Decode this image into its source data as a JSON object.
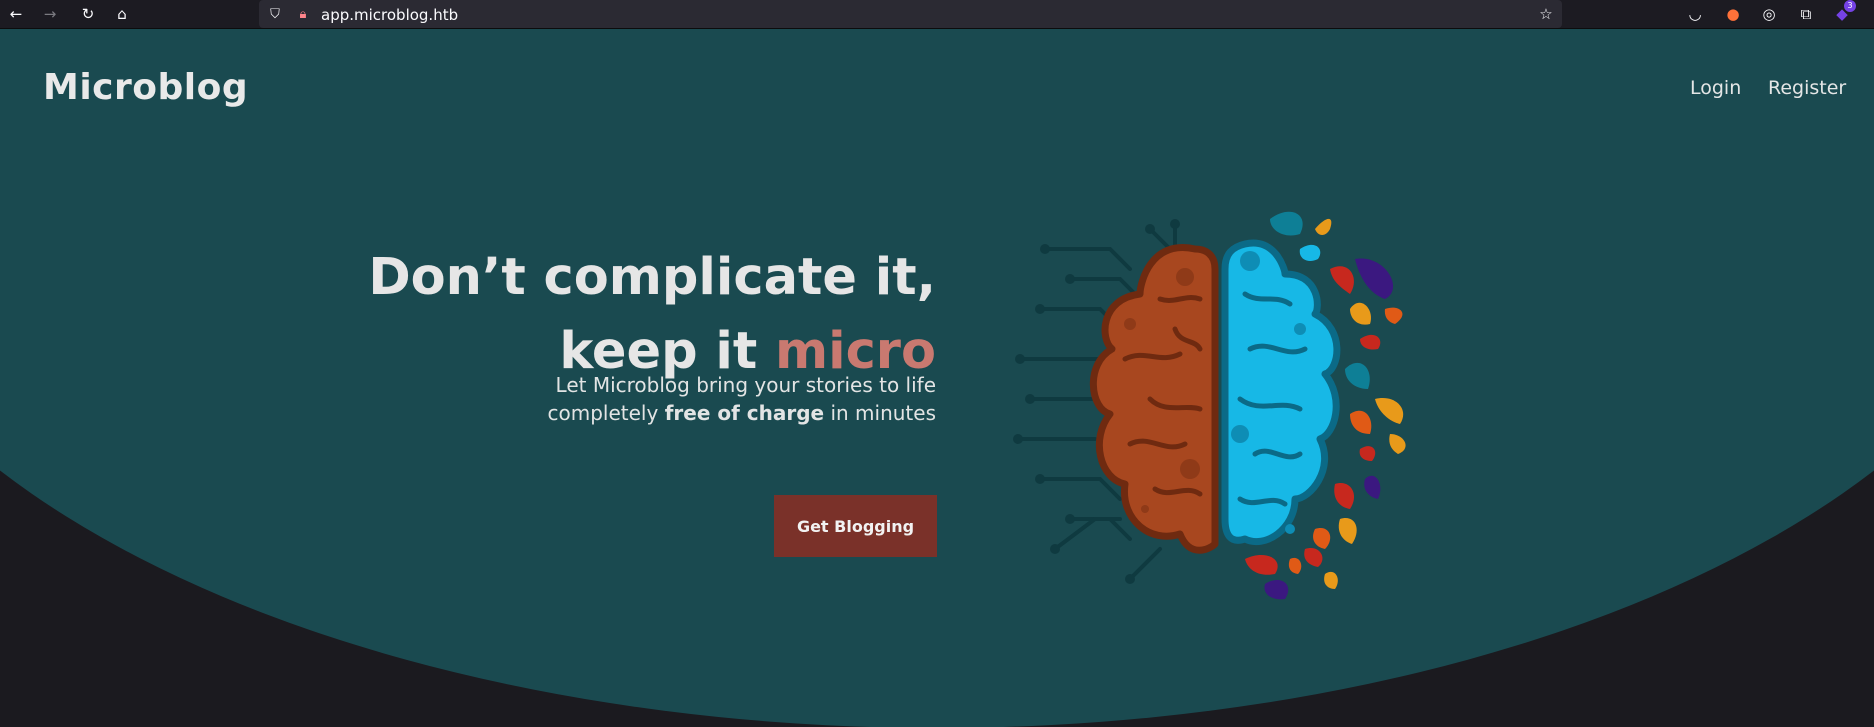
{
  "browser": {
    "url_host": "app.microblog.htb",
    "extension_badge": "3"
  },
  "nav": {
    "brand": "Microblog",
    "login": "Login",
    "register": "Register"
  },
  "hero": {
    "headline_line1": "Don’t complicate it,",
    "headline_line2_prefix": "keep it ",
    "headline_line2_accent": "micro",
    "sub_line1": "Let Microblog bring your stories to life",
    "sub_line2_prefix": "completely ",
    "sub_line2_bold": "free of charge",
    "sub_line2_suffix": " in minutes",
    "cta_label": "Get Blogging"
  },
  "colors": {
    "hero_bg": "#1a4a50",
    "page_bg": "#1b1a1f",
    "accent_text": "#c97970",
    "cta_bg": "#7a3129",
    "brain_left": "#a8471f",
    "brain_right": "#17b8e6"
  },
  "icons": [
    "back-icon",
    "forward-icon",
    "reload-icon",
    "home-icon",
    "shield-icon",
    "lock-icon",
    "bookmark-star-icon",
    "pocket-icon",
    "firefox-icon",
    "extension-icon",
    "puzzle-icon",
    "profile-extension-icon"
  ]
}
